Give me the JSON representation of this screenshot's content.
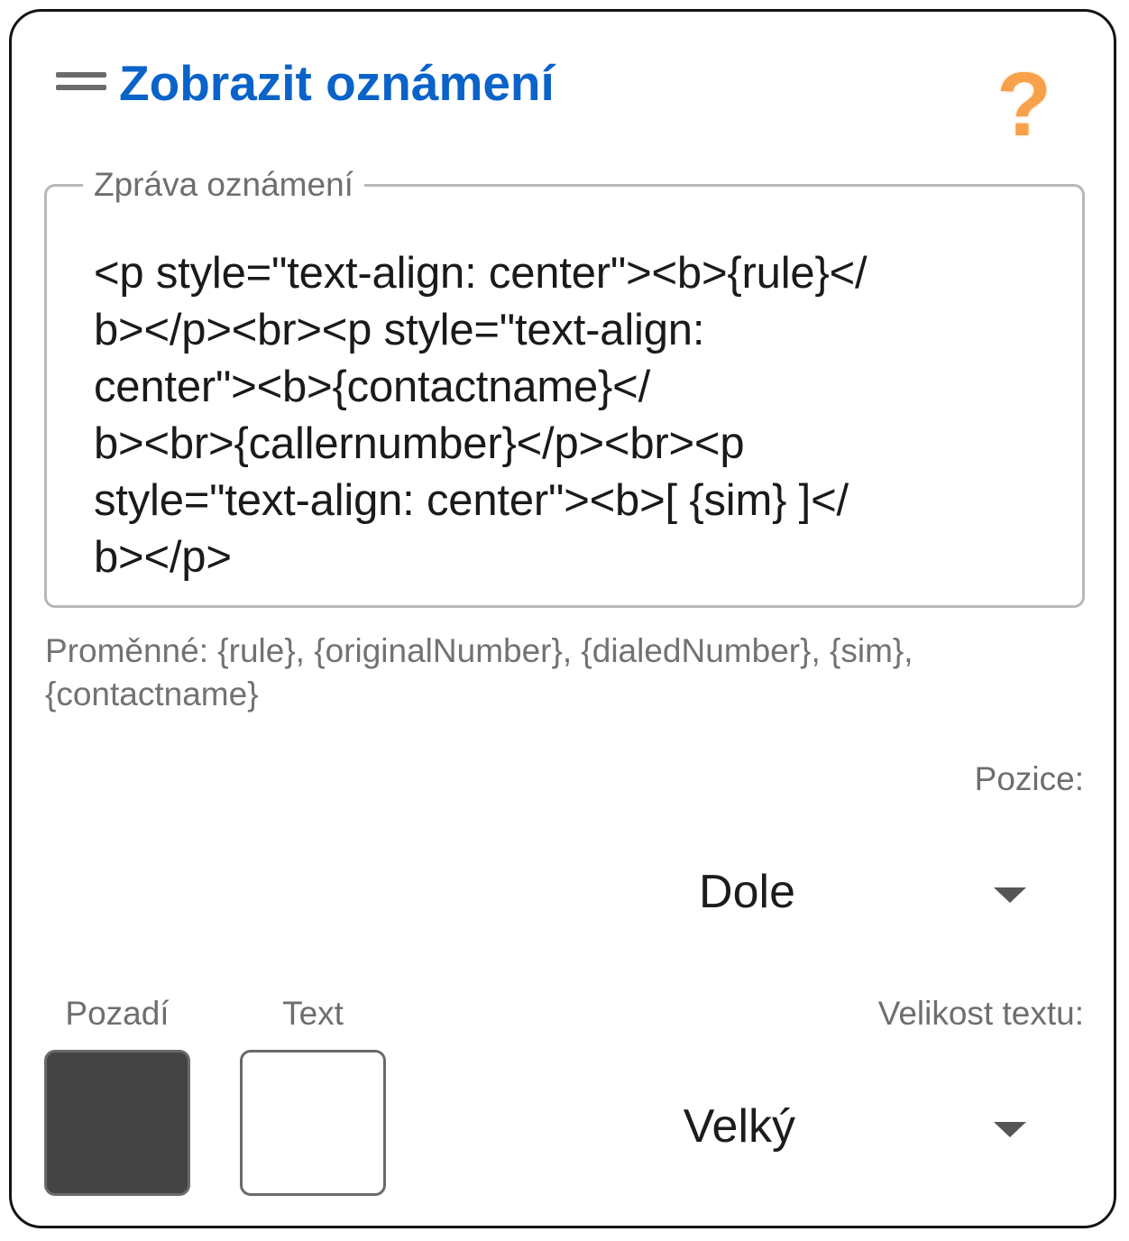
{
  "header": {
    "title": "Zobrazit oznámení",
    "drag_icon": "drag-handle-icon",
    "help_icon": "help-icon",
    "help_glyph": "?",
    "help_color": "#f7a14a",
    "title_color": "#0a63c9"
  },
  "message": {
    "legend": "Zpráva oznámení",
    "value": "<p style=\"text-align: center\"><b>{rule}</\nb></p><br><p style=\"text-align:\ncenter\"><b>{contactname}</\nb><br>{callernumber}</p><br><p\nstyle=\"text-align: center\"><b>[ {sim} ]</\nb></p>"
  },
  "variables_hint": "Proměnné: {rule}, {originalNumber}, {dialedNumber}, {sim},\n{contactname}",
  "position": {
    "label": "Pozice:",
    "selected": "Dole"
  },
  "colors": {
    "background_label": "Pozadí",
    "background_value": "#444444",
    "text_label": "Text",
    "text_value": "#ffffff"
  },
  "text_size": {
    "label": "Velikost textu:",
    "selected": "Velký"
  }
}
